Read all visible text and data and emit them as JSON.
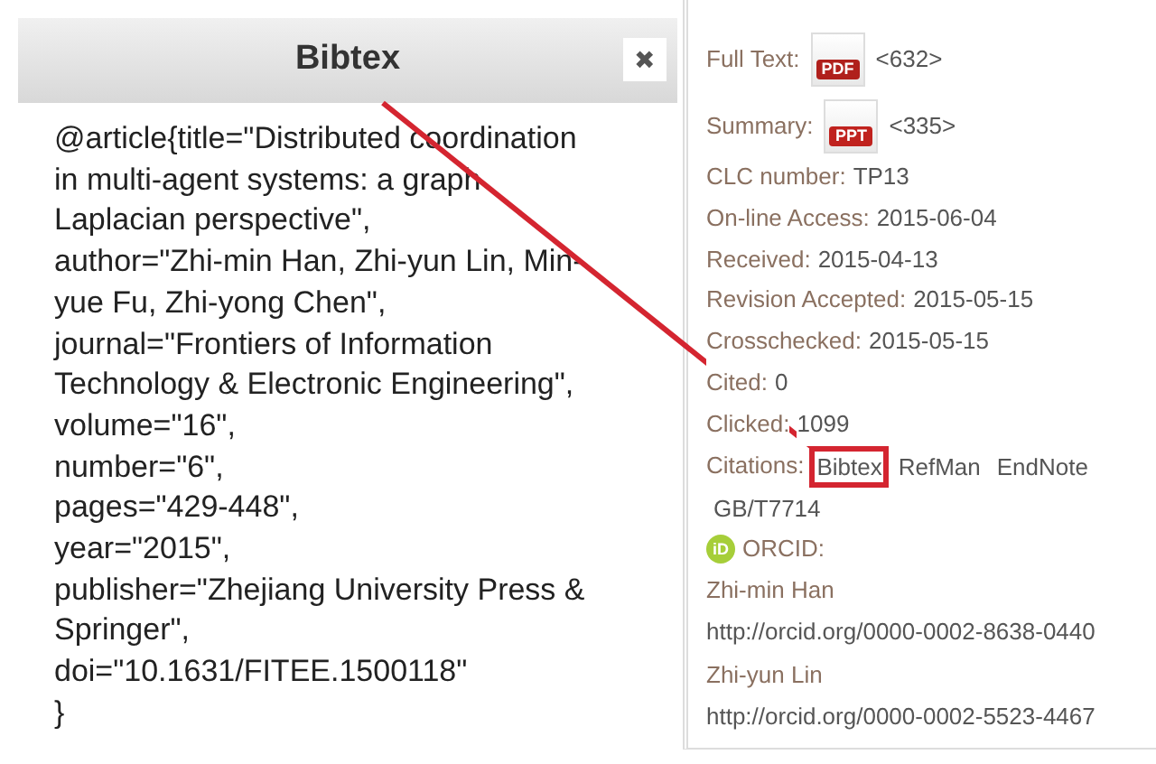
{
  "dialog": {
    "title": "Bibtex",
    "close": "✖",
    "lines": [
      "@article{title=\"Distributed coordination",
      "in multi-agent systems: a graph",
      "Laplacian perspective\",",
      "author=\"Zhi-min Han, Zhi-yun Lin, Min-",
      "yue Fu, Zhi-yong Chen\",",
      "journal=\"Frontiers of Information",
      "Technology & Electronic Engineering\",",
      "volume=\"16\",",
      "number=\"6\",",
      "pages=\"429-448\",",
      "year=\"2015\",",
      "publisher=\"Zhejiang University Press &",
      "Springer\",",
      "doi=\"10.1631/FITEE.1500118\"",
      "}"
    ]
  },
  "sidebar": {
    "downloads": [
      {
        "label": "Full Text:",
        "kind": "pdf",
        "icon_text": "PDF",
        "count": "<632>"
      },
      {
        "label": "Summary:",
        "kind": "ppt",
        "icon_text": "PPT",
        "count": "<335>"
      }
    ],
    "fields": [
      {
        "label": "CLC number:",
        "value": "TP13"
      },
      {
        "label": "On-line Access:",
        "value": "2015-06-04"
      },
      {
        "label": "Received:",
        "value": "2015-04-13"
      },
      {
        "label": "Revision Accepted:",
        "value": "2015-05-15"
      },
      {
        "label": "Crosschecked:",
        "value": "2015-05-15"
      },
      {
        "label": "Cited:",
        "value": "0"
      },
      {
        "label": "Clicked:",
        "value": "1099"
      }
    ],
    "citations": {
      "label": "Citations:",
      "links": [
        {
          "text": "Bibtex",
          "highlighted": true
        },
        {
          "text": "RefMan",
          "highlighted": false
        },
        {
          "text": "EndNote",
          "highlighted": false
        },
        {
          "text": "GB/T7714",
          "highlighted": false
        }
      ]
    },
    "orcid": {
      "icon_text": "iD",
      "label": "ORCID:",
      "authors": [
        {
          "name": "Zhi-min Han",
          "url": "http://orcid.org/0000-0002-8638-0440"
        },
        {
          "name": "Zhi-yun Lin",
          "url": "http://orcid.org/0000-0002-5523-4467"
        }
      ]
    }
  }
}
